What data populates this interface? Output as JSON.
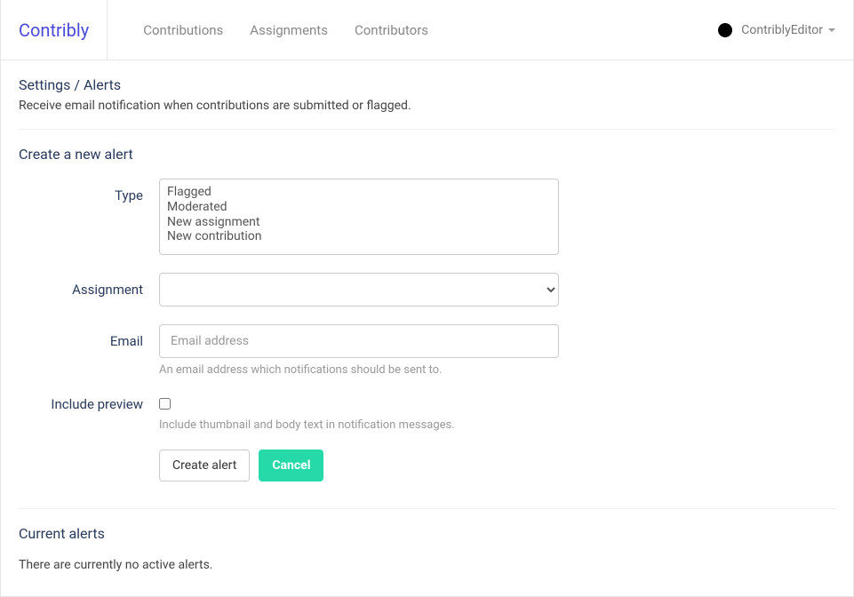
{
  "brand": "Contribly",
  "nav": {
    "contributions": "Contributions",
    "assignments": "Assignments",
    "contributors": "Contributors"
  },
  "user": {
    "name": "ContriblyEditor"
  },
  "breadcrumb": "Settings / Alerts",
  "description": "Receive email notification when contributions are submitted or flagged.",
  "createSection": {
    "title": "Create a new alert",
    "typeLabel": "Type",
    "typeOptions": [
      "Flagged",
      "Moderated",
      "New assignment",
      "New contribution"
    ],
    "assignmentLabel": "Assignment",
    "assignmentValue": "",
    "emailLabel": "Email",
    "emailPlaceholder": "Email address",
    "emailValue": "",
    "emailHelp": "An email address which notifications should be sent to.",
    "previewLabel": "Include preview",
    "previewHelp": "Include thumbnail and body text in notification messages.",
    "createButton": "Create alert",
    "cancelButton": "Cancel"
  },
  "currentSection": {
    "title": "Current alerts",
    "empty": "There are currently no active alerts."
  }
}
